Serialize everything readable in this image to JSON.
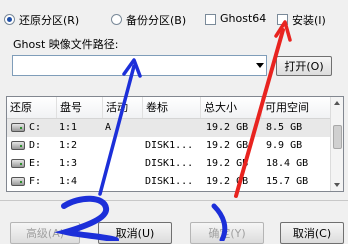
{
  "mode_options": {
    "restore": {
      "label": "还原分区(R)",
      "selected": true
    },
    "backup": {
      "label": "备份分区(B)",
      "selected": false
    },
    "ghost64": {
      "label": "Ghost64",
      "checked": false
    },
    "install": {
      "label": "安装(I)",
      "checked": false
    }
  },
  "path": {
    "label": "Ghost 映像文件路径:",
    "value": "",
    "open_label": "打开(O)"
  },
  "table": {
    "headers": [
      "还原",
      "盘号",
      "活动",
      "卷标",
      "总大小",
      "可用空间"
    ],
    "rows": [
      {
        "drive": "C:",
        "num": "1:1",
        "active": "A",
        "label": "",
        "total": "19.2 GB",
        "free": "8.5 GB",
        "selected": true
      },
      {
        "drive": "D:",
        "num": "1:2",
        "active": "",
        "label": "DISK1...",
        "total": "19.2 GB",
        "free": "9.9 GB",
        "selected": false
      },
      {
        "drive": "E:",
        "num": "1:3",
        "active": "",
        "label": "DISK1...",
        "total": "19.2 GB",
        "free": "18.4 GB",
        "selected": false
      },
      {
        "drive": "F:",
        "num": "1:4",
        "active": "",
        "label": "DISK1...",
        "total": "19.2 GB",
        "free": "15.7 GB",
        "selected": false
      }
    ]
  },
  "buttons": {
    "advanced": "高级(A)",
    "cancel": "取消(U)",
    "confirm": "确定(Y)",
    "close": "取消(C)"
  },
  "annotations": {
    "red_color": "#e8231f",
    "blue_color": "#1c2fd9",
    "num_two": "2"
  }
}
